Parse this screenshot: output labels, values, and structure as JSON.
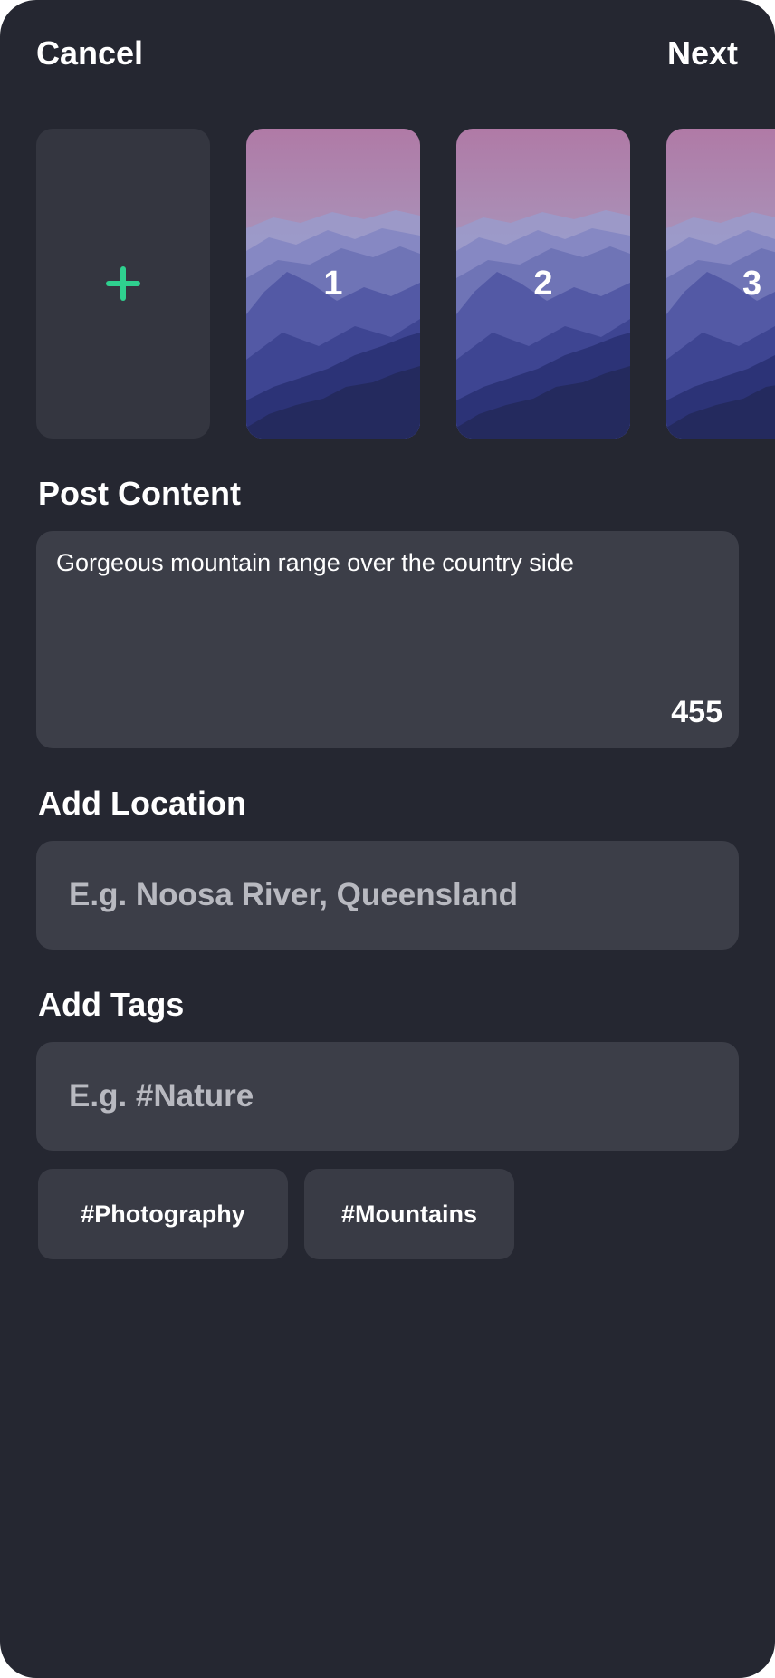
{
  "header": {
    "cancel_label": "Cancel",
    "next_label": "Next"
  },
  "media": {
    "add_icon": "plus-icon",
    "thumbnails": [
      {
        "number": "1"
      },
      {
        "number": "2"
      },
      {
        "number": "3"
      }
    ]
  },
  "post_content": {
    "label": "Post Content",
    "text": "Gorgeous mountain range over the country side",
    "char_count": "455"
  },
  "location": {
    "label": "Add Location",
    "placeholder": "E.g. Noosa River, Queensland"
  },
  "tags": {
    "label": "Add Tags",
    "placeholder": "E.g. #Nature",
    "chips": [
      "#Photography",
      "#Mountains"
    ]
  },
  "colors": {
    "background": "#252731",
    "card": "#3c3e48",
    "accent": "#2fd08f"
  }
}
